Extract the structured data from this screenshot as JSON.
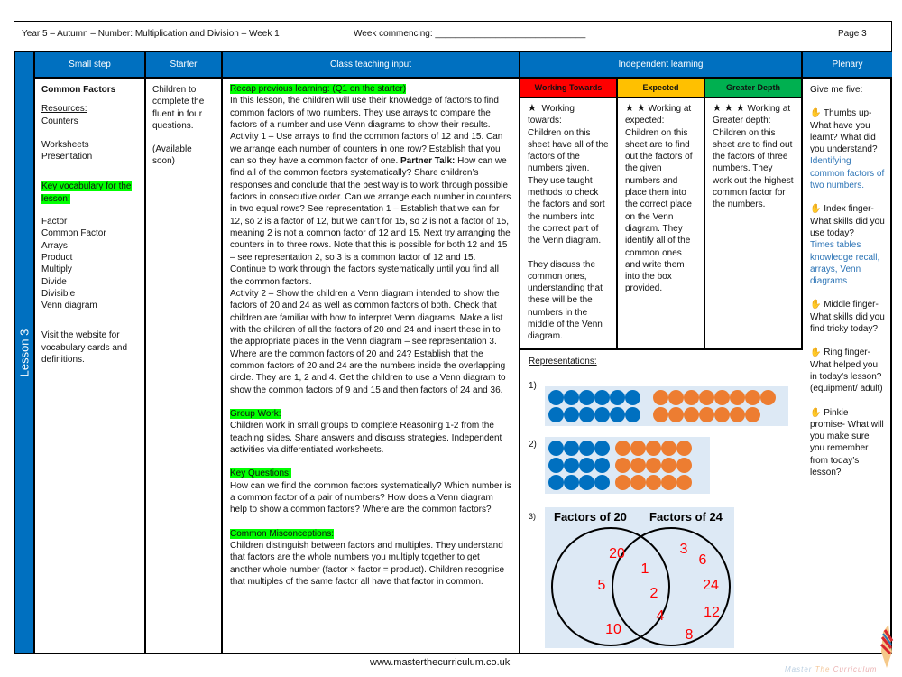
{
  "header": {
    "title": "Year 5 – Autumn – Number: Multiplication and Division – Week 1",
    "week_commencing": "Week commencing: ______________________________",
    "page": "Page 3"
  },
  "lesson_label": "Lesson 3",
  "columns": {
    "small_step": "Small step",
    "starter": "Starter",
    "class_teaching": "Class teaching input",
    "independent": "Independent learning",
    "plenary": "Plenary"
  },
  "small_step": {
    "title": "Common Factors",
    "resources_label": "Resources:",
    "resources": [
      "Counters",
      "Worksheets",
      "Presentation"
    ],
    "vocab_label": "Key vocabulary for the lesson:",
    "vocab": [
      "Factor",
      "Common Factor",
      "Arrays",
      "Product",
      "Multiply",
      "Divide",
      "Divisible",
      "Venn diagram"
    ],
    "website_note": "Visit the website for vocabulary cards and definitions."
  },
  "starter": {
    "text": "Children to complete the fluent in four questions.",
    "note": "(Available soon)"
  },
  "teaching": {
    "recap_label": "Recap previous learning: (Q1 on the starter)",
    "para1_a": "In this lesson, the children will use their knowledge of factors to find common factors of two numbers. They use arrays to compare the factors of a number and use Venn diagrams to show their results. Activity 1 – Use arrays to find the common factors of 12 and 15. Can we arrange each number of counters in one row? Establish that you can so they have a common factor of one. ",
    "partner_label": "Partner Talk:",
    "para1_b": " How can we find all of the common factors systematically? Share children’s responses and conclude that the best way is to work through possible factors in consecutive order. Can we arrange each number in counters in two equal rows? See representation 1 – Establish that we can for 12, so 2 is a factor of 12, but we can’t for 15, so 2 is not a factor of 15, meaning 2 is not a common factor of 12 and 15. Next try arranging the counters in to three rows. Note that this is possible for both 12 and 15 – see representation 2, so 3 is a common factor of 12 and 15. Continue to work through the factors systematically until you find all the common factors.",
    "para2": "Activity 2 – Show the children a Venn diagram intended to show the factors of 20 and 24 as well as common factors of both. Check that children are familiar with how to interpret Venn diagrams. Make a list with the children of all the factors of 20 and 24 and insert these in to the appropriate places in the  Venn diagram – see representation 3. Where are the common factors of 20 and 24? Establish that the common factors of 20 and 24 are the numbers inside the overlapping circle. They are 1, 2 and 4. Get the children to use a Venn diagram to show the common factors of 9 and 15 and then factors of 24 and 36.",
    "group_label": "Group Work:",
    "group_text": "Children work in small groups to complete Reasoning 1-2 from the teaching slides. Share answers and discuss strategies. Independent activities via differentiated worksheets.",
    "questions_label": "Key Questions:",
    "questions_text": "How can we find the common factors systematically? Which number is a common factor of a pair of numbers? How does a Venn diagram help to show a common factors?  Where are the common factors?",
    "misconceptions_label": "Common Misconceptions:",
    "misconceptions_text": "Children distinguish between factors and multiples. They understand that factors are the whole numbers you multiply together to get another whole number (factor × factor = product). Children recognise that multiples of the same factor all have that factor in common."
  },
  "independent": {
    "levels": [
      {
        "label": "Working Towards",
        "color": "#ff0000",
        "stars": "★",
        "heading": "Working towards:",
        "text": "Children on this sheet have all of the factors of the numbers given. They use taught methods to check the factors and sort the numbers into the correct part of the Venn diagram.",
        "text2": "They discuss the common ones, understanding that these will be the numbers in the middle of the Venn diagram."
      },
      {
        "label": "Expected",
        "color": "#ffc000",
        "stars": "★ ★",
        "heading": "Working at expected:",
        "text": "Children on this sheet are to find out the factors of the given numbers and place them into the correct place on the Venn diagram. They identify all of the common ones and write them into the box provided."
      },
      {
        "label": "Greater Depth",
        "color": "#00b050",
        "stars": "★ ★ ★",
        "heading": "Working at Greater depth:",
        "text": "Children on this sheet are to find out the factors of three numbers. They work out the highest common factor for the numbers."
      }
    ],
    "representations_label": "Representations:",
    "rep1_label": "1)",
    "rep2_label": "2)",
    "rep3_label": "3)",
    "rep1": {
      "blue_rows": [
        6,
        6
      ],
      "orange_rows": [
        8,
        7
      ]
    },
    "rep2": {
      "blue_rows": [
        4,
        4,
        4
      ],
      "orange_rows": [
        5,
        5,
        5
      ]
    },
    "venn": {
      "left_title": "Factors of 20",
      "right_title": "Factors of 24",
      "left_only": [
        "20",
        "5",
        "10"
      ],
      "both": [
        "1",
        "2",
        "4"
      ],
      "right_only": [
        "3",
        "6",
        "24",
        "12",
        "8"
      ]
    },
    "colors": {
      "blue": "#0070c0",
      "orange": "#ed7d31",
      "venn_numbers": "#ff0000"
    }
  },
  "plenary": {
    "intro": "Give me five:",
    "items": [
      {
        "q": " Thumbs up- What have you learnt? What did you understand?",
        "a": "Identifying common factors of two numbers."
      },
      {
        "q": " Index finger- What skills did you use today?",
        "a": "Times tables knowledge recall, arrays, Venn diagrams"
      },
      {
        "q": " Middle finger- What skills did you find tricky today?"
      },
      {
        "q": " Ring finger- What helped you in today’s lesson? (equipment/ adult)"
      },
      {
        "q": " Pinkie promise- What will you make sure you remember from today’s lesson?"
      }
    ]
  },
  "footer": {
    "url": "www.masterthecurriculum.co.uk",
    "logo_text": "Master The Curriculum"
  }
}
